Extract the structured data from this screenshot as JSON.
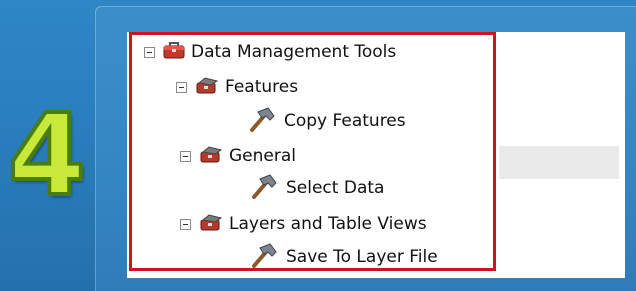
{
  "step_number": "4",
  "tree": {
    "root": {
      "label": "Data Management Tools",
      "icon": "toolbox-icon"
    },
    "toolsets": [
      {
        "label": "Features",
        "icon": "toolset-icon",
        "tool": {
          "label": "Copy Features",
          "icon": "hammer-icon"
        }
      },
      {
        "label": "General",
        "icon": "toolset-icon",
        "tool": {
          "label": "Select Data",
          "icon": "hammer-icon"
        }
      },
      {
        "label": "Layers and Table Views",
        "icon": "toolset-icon",
        "tool": {
          "label": "Save To Layer File",
          "icon": "hammer-icon"
        }
      }
    ]
  },
  "colors": {
    "highlight": "#d0111e",
    "step_fill": "#c8e83a",
    "background": "#2a7fbe"
  }
}
